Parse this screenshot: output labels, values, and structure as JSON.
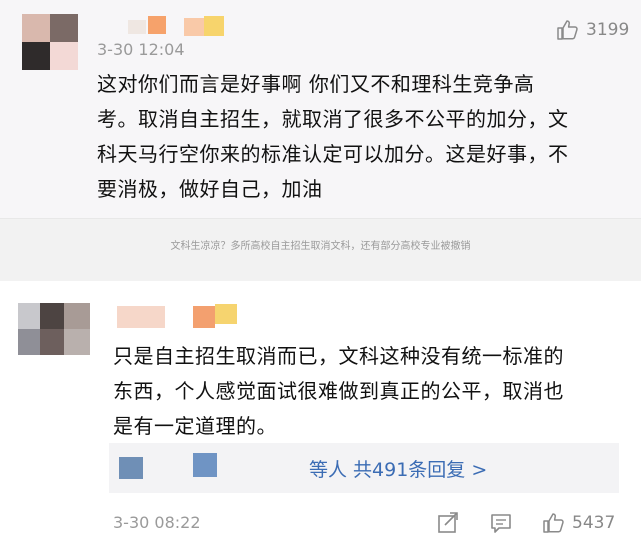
{
  "comment1": {
    "timestamp": "3-30 12:04",
    "likes": "3199",
    "text": "这对你们而言是好事啊 你们又不和理科生竞争高考。取消自主招生，就取消了很多不公平的加分，文科天马行空你来的标准认定可以加分。这是好事，不要消极，做好自己，加油",
    "lines": [
      "这对你们而言是好事啊 你们又不和理科生竞争高",
      "考。取消自主招生，就取消了很多不公平的加分，文",
      "科天马行空你来的标准认定可以加分。这是好事，不",
      "要消极，做好自己，加油"
    ]
  },
  "caption": "文科生凉凉？多所高校自主招生取消文科，还有部分高校专业被撤销",
  "comment2": {
    "lines": [
      "只是自主招生取消而已，文科这种没有统一标准的",
      "东西，个人感觉面试很难做到真正的公平，取消也",
      "是有一定道理的。"
    ],
    "reply_link": "等人 共491条回复 >",
    "timestamp": "3-30 08:22",
    "likes": "5437"
  },
  "icons": {
    "like": "thumbs-up-icon",
    "share": "share-icon",
    "comment": "comment-icon"
  },
  "colors": {
    "link": "#3b6cb4",
    "muted": "#9a9a9a",
    "background_top": "#f7f6f8"
  }
}
